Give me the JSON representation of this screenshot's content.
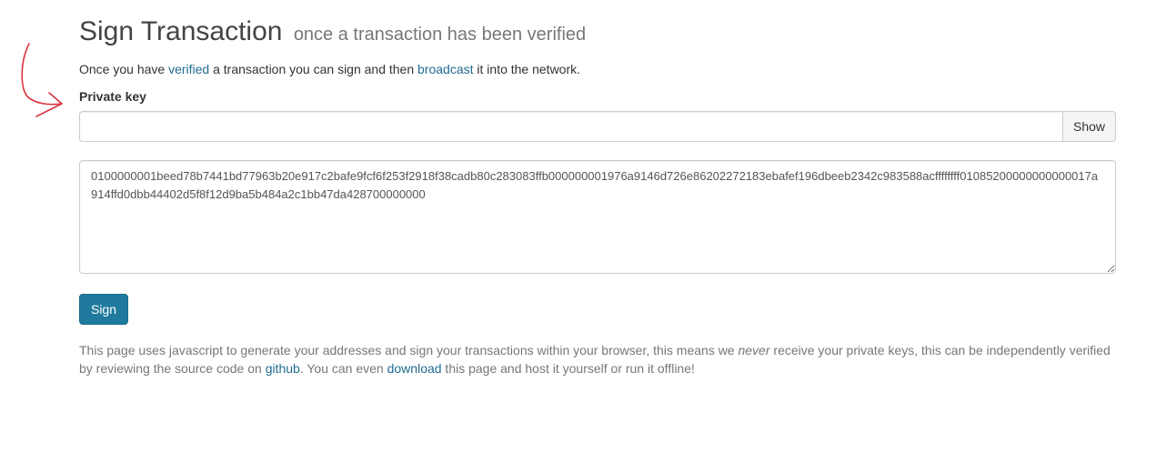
{
  "header": {
    "title": "Sign Transaction",
    "subtitle": "once a transaction has been verified"
  },
  "intro": {
    "text_1": "Once you have ",
    "link_verified": "verified",
    "text_2": " a transaction you can sign and then ",
    "link_broadcast": "broadcast",
    "text_3": " it into the network."
  },
  "private_key": {
    "label": "Private key",
    "value": "",
    "placeholder": "",
    "show_label": "Show"
  },
  "transaction": {
    "value": "0100000001beed78b7441bd77963b20e917c2bafe9fcf6f253f2918f38cadb80c283083ffb000000001976a9146d726e86202272183ebafef196dbeeb2342c983588acffffffff01085200000000000017a914ffd0dbb44402d5f8f12d9ba5b484a2c1bb47da428700000000"
  },
  "sign_button": {
    "label": "Sign"
  },
  "footer": {
    "text_1": "This page uses javascript to generate your addresses and sign your transactions within your browser, this means we ",
    "emphasis": "never",
    "text_2": " receive your private keys, this can be independently verified by reviewing the source code on ",
    "link_github": "github",
    "text_3": ". You can even ",
    "link_download": "download",
    "text_4": " this page and host it yourself or run it offline!"
  },
  "colors": {
    "annotation_arrow": "#d9343f",
    "link": "#1f6c8f",
    "primary_button": "#1f7a9e"
  }
}
